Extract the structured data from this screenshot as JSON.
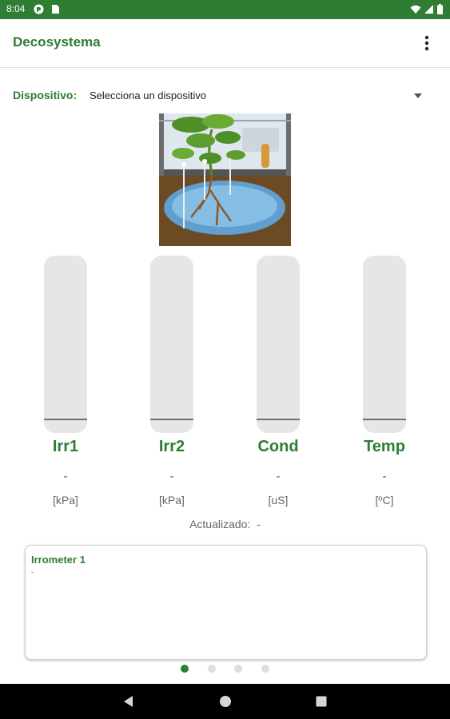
{
  "status_bar": {
    "time": "8:04",
    "color": "#2e7d32",
    "icons": [
      "notification-icon",
      "sim-card-icon",
      "wifi-icon",
      "signal-icon",
      "battery-icon"
    ]
  },
  "app_bar": {
    "title": "Decosystema",
    "menu_icon": "more-vert-icon"
  },
  "device": {
    "label": "Dispositivo:",
    "selected": "Selecciona un dispositivo",
    "dropdown_icon": "dropdown-arrow-icon"
  },
  "gauges": [
    {
      "name": "Irr1",
      "value": "-",
      "unit": "[kPa]",
      "level": 0
    },
    {
      "name": "Irr2",
      "value": "-",
      "unit": "[kPa]",
      "level": 0
    },
    {
      "name": "Cond",
      "value": "-",
      "unit": "[uS]",
      "level": 0
    },
    {
      "name": "Temp",
      "value": "-",
      "unit": "[ºC]",
      "level": 0
    }
  ],
  "updated": {
    "label": "Actualizado:",
    "value": "-"
  },
  "card": {
    "title": "Irrometer 1",
    "value": "-"
  },
  "pager": {
    "count": 4,
    "active_index": 0
  },
  "nav": {
    "back": "back-icon",
    "home": "home-icon",
    "recents": "recents-icon"
  },
  "colors": {
    "accent": "#2e7d32",
    "gauge_track": "#e6e6e6",
    "navbar": "#000000"
  }
}
